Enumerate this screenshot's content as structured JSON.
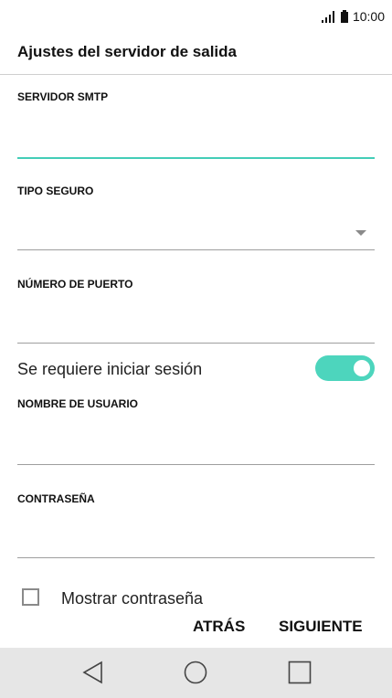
{
  "status_bar": {
    "time": "10:00",
    "signal_icon": "signal-bars-icon",
    "battery_icon": "battery-icon"
  },
  "header": {
    "title": "Ajustes del servidor de salida"
  },
  "form": {
    "smtp_server": {
      "label": "SERVIDOR SMTP",
      "value": ""
    },
    "security_type": {
      "label": "TIPO SEGURO",
      "value": ""
    },
    "port_number": {
      "label": "NÚMERO DE PUERTO",
      "value": ""
    },
    "login_required": {
      "label": "Se requiere iniciar sesión",
      "enabled": true
    },
    "username": {
      "label": "NOMBRE DE USUARIO",
      "value": ""
    },
    "password": {
      "label": "CONTRASEÑA",
      "value": ""
    },
    "show_password": {
      "label": "Mostrar contraseña",
      "checked": false
    }
  },
  "actions": {
    "back_label": "ATRÁS",
    "next_label": "SIGUIENTE"
  },
  "colors": {
    "accent": "#4dd5bd",
    "focus_line": "#43cdb7",
    "nav_bar_bg": "#e6e6e6"
  }
}
